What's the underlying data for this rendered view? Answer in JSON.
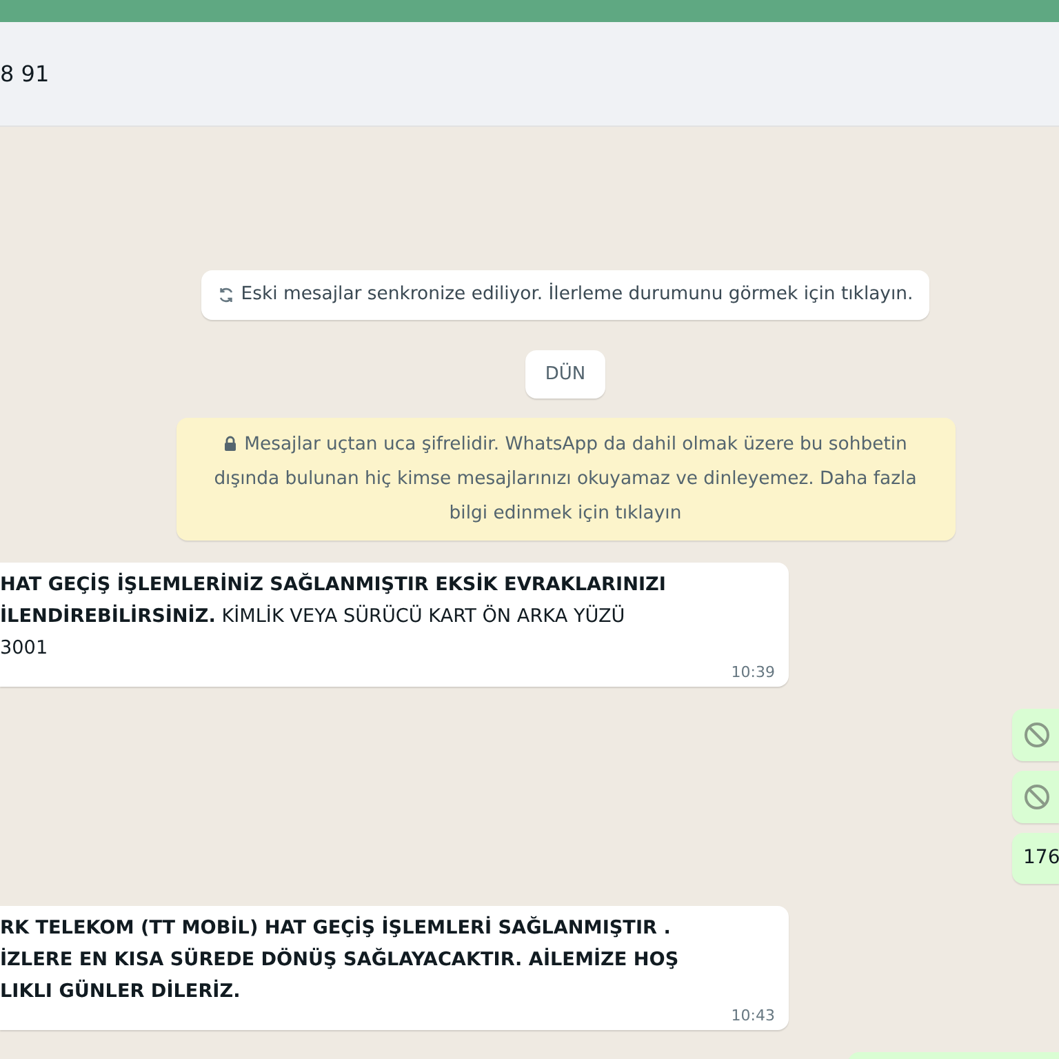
{
  "header": {
    "title": "8 91"
  },
  "sync_notice": {
    "text": "Eski mesajlar senkronize ediliyor. İlerleme durumunu görmek için tıklayın."
  },
  "date_chip": {
    "text": "DÜN"
  },
  "encryption_notice": {
    "text": "Mesajlar uçtan uca şifrelidir. WhatsApp da dahil olmak üzere bu sohbetin dışında bulunan hiç kimse mesajlarınızı okuyamaz ve dinleyemez. Daha fazla bilgi edinmek için tıklayın"
  },
  "messages": [
    {
      "kind": "incoming",
      "bold": false,
      "text": "**HAT GEÇİŞ İŞLEMLERİNİZ SAĞLANMIŞTIR EKSİK EVRAKLARINIZI**\n**İLENDİREBİLİRSİNİZ.** KİMLİK VEYA SÜRÜCÜ KART ÖN ARKA YÜZÜ\n3001",
      "time": "10:39"
    },
    {
      "kind": "deleted"
    },
    {
      "kind": "deleted"
    },
    {
      "kind": "outgoing",
      "text": "176"
    },
    {
      "kind": "incoming",
      "bold": true,
      "text": "RK TELEKOM (TT MOBİL) HAT GEÇİŞ İŞLEMLERİ SAĞLANMIŞTIR .\nİZLERE EN KISA SÜREDE DÖNÜŞ SAĞLAYACAKTIR. AİLEMİZE HOŞ\nLIKLI GÜNLER DİLERİZ.",
      "time": "10:43"
    },
    {
      "kind": "outgoing_partial"
    }
  ]
}
